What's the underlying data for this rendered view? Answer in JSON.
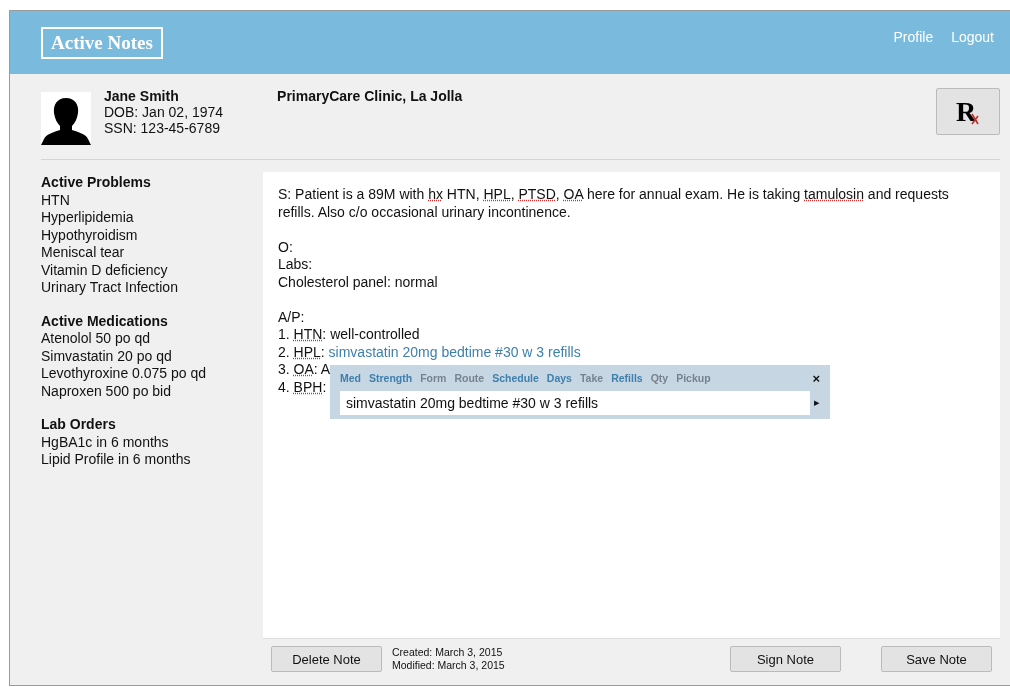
{
  "header": {
    "logo": "Active Notes",
    "links": [
      "Profile",
      "Logout"
    ]
  },
  "patient": {
    "name": "Jane Smith",
    "dob": "DOB: Jan 02, 1974",
    "ssn": "SSN: 123-45-6789",
    "clinic": "PrimaryCare Clinic, La Jolla"
  },
  "rx_button": {
    "label": "R"
  },
  "sidebar": [
    {
      "title": "Active Problems",
      "items": [
        "HTN",
        "Hyperlipidemia",
        "Hypothyroidism",
        "Meniscal tear",
        "Vitamin D deficiency",
        "Urinary Tract Infection"
      ]
    },
    {
      "title": "Active Medications",
      "items": [
        "Atenolol 50 po qd",
        "Simvastatin 20 po qd",
        "Levothyroxine 0.075 po qd",
        "Naproxen 500 po bid"
      ]
    },
    {
      "title": "Lab Orders",
      "items": [
        "HgBA1c in 6 months",
        "Lipid Profile in 6 months"
      ]
    }
  ],
  "note": {
    "sections": [
      {
        "lines": [
          [
            {
              "text": "S: Patient is a 89M with ",
              "kind": "plain"
            },
            {
              "text": "hx",
              "kind": "flagged"
            },
            {
              "text": " HTN, ",
              "kind": "plain"
            },
            {
              "text": "HPL",
              "kind": "flagged"
            },
            {
              "text": ", ",
              "kind": "plain"
            },
            {
              "text": "PTSD",
              "kind": "flagged"
            },
            {
              "text": ", ",
              "kind": "plain"
            },
            {
              "text": "OA",
              "kind": "flagged"
            },
            {
              "text": " here for annual exam. He is taking ",
              "kind": "plain"
            },
            {
              "text": "tamulosin",
              "kind": "flagged"
            },
            {
              "text": " and requests refills. Also c/o occasional urinary incontinence.",
              "kind": "plain"
            }
          ]
        ]
      },
      {
        "lines": [
          [
            {
              "text": "O:",
              "kind": "plain"
            }
          ],
          [
            {
              "text": "Labs:",
              "kind": "plain"
            }
          ],
          [
            {
              "text": "Cholesterol panel: normal",
              "kind": "plain"
            }
          ]
        ]
      },
      {
        "lines": [
          [
            {
              "text": "A/P:",
              "kind": "plain"
            }
          ],
          [
            {
              "text": "1. ",
              "kind": "plain"
            },
            {
              "text": "HTN",
              "kind": "flagged"
            },
            {
              "text": ": well-controlled",
              "kind": "plain"
            }
          ],
          [
            {
              "text": "2. ",
              "kind": "plain"
            },
            {
              "text": "HPL",
              "kind": "flagged"
            },
            {
              "text": ": ",
              "kind": "plain"
            },
            {
              "text": "simvastatin 20mg bedtime #30 w 3 refills",
              "kind": "order"
            }
          ],
          [
            {
              "text": "3. ",
              "kind": "plain"
            },
            {
              "text": "OA",
              "kind": "flagged"
            },
            {
              "text": ": A",
              "kind": "plain"
            }
          ],
          [
            {
              "text": "4. ",
              "kind": "plain"
            },
            {
              "text": "BPH",
              "kind": "flagged"
            },
            {
              "text": ":",
              "kind": "plain"
            }
          ]
        ]
      }
    ]
  },
  "order_popup": {
    "fields": [
      {
        "label": "Med",
        "filled": true
      },
      {
        "label": "Strength",
        "filled": true
      },
      {
        "label": "Form",
        "filled": false
      },
      {
        "label": "Route",
        "filled": false
      },
      {
        "label": "Schedule",
        "filled": true
      },
      {
        "label": "Days",
        "filled": true
      },
      {
        "label": "Take",
        "filled": false
      },
      {
        "label": "Refills",
        "filled": true
      },
      {
        "label": "Qty",
        "filled": false
      },
      {
        "label": "Pickup",
        "filled": false
      }
    ],
    "close": "×",
    "value": "simvastatin 20mg bedtime #30 w 3 refills",
    "next": "▸"
  },
  "footer": {
    "delete": "Delete Note",
    "created": "Created: March 3, 2015",
    "modified": "Modified: March 3, 2015",
    "sign": "Sign Note",
    "save": "Save Note"
  }
}
